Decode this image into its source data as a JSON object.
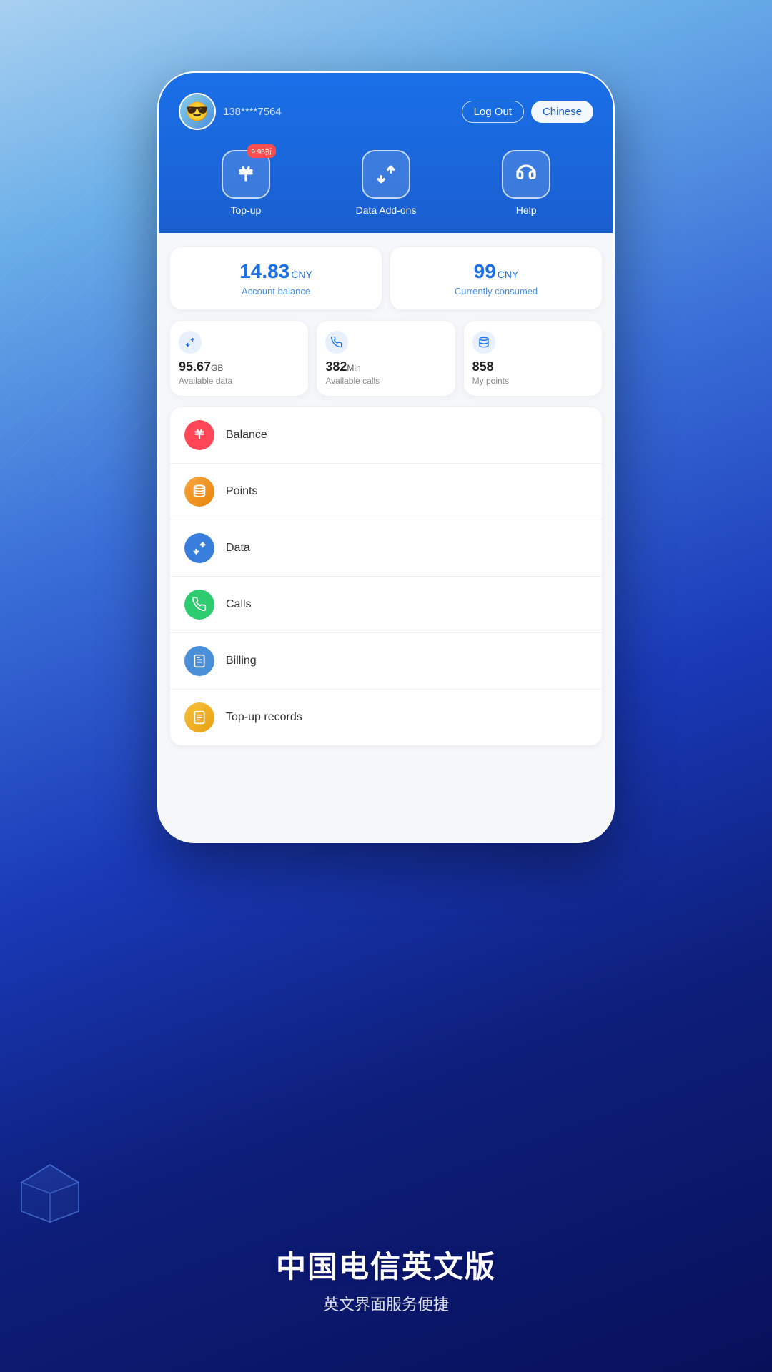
{
  "background": {
    "description": "Blue gradient with tech lines"
  },
  "header": {
    "username": "138****7564",
    "logout_label": "Log Out",
    "language_label": "Chinese",
    "avatar_emoji": "😎"
  },
  "quick_actions": [
    {
      "id": "topup",
      "label": "Top-up",
      "badge": "9.95折",
      "icon": "yuan"
    },
    {
      "id": "data-addons",
      "label": "Data Add-ons",
      "icon": "data"
    },
    {
      "id": "help",
      "label": "Help",
      "icon": "help"
    }
  ],
  "balance_cards": [
    {
      "id": "account-balance",
      "amount": "14.83",
      "unit": "CNY",
      "label": "Account balance"
    },
    {
      "id": "currently-consumed",
      "amount": "99",
      "unit": "CNY",
      "label": "Currently consumed"
    }
  ],
  "stats": [
    {
      "id": "available-data",
      "value": "95.67",
      "unit": "GB",
      "label": "Available data",
      "icon": "data"
    },
    {
      "id": "available-calls",
      "value": "382",
      "unit": "Min",
      "label": "Available calls",
      "icon": "phone"
    },
    {
      "id": "my-points",
      "value": "858",
      "unit": "",
      "label": "My points",
      "icon": "points"
    }
  ],
  "menu_items": [
    {
      "id": "balance-menu",
      "label": "Balance",
      "color": "red",
      "icon": "yuan"
    },
    {
      "id": "points-menu",
      "label": "Points",
      "color": "orange",
      "icon": "stack"
    },
    {
      "id": "data-menu",
      "label": "Data",
      "color": "blue",
      "icon": "data"
    },
    {
      "id": "calls-menu",
      "label": "Calls",
      "color": "green",
      "icon": "phone"
    },
    {
      "id": "billing-menu",
      "label": "Billing",
      "color": "blue2",
      "icon": "bill"
    },
    {
      "id": "topup-records-menu",
      "label": "Top-up records",
      "color": "yellow",
      "icon": "doc"
    }
  ],
  "footer": {
    "title": "中国电信英文版",
    "subtitle": "英文界面服务便捷"
  }
}
